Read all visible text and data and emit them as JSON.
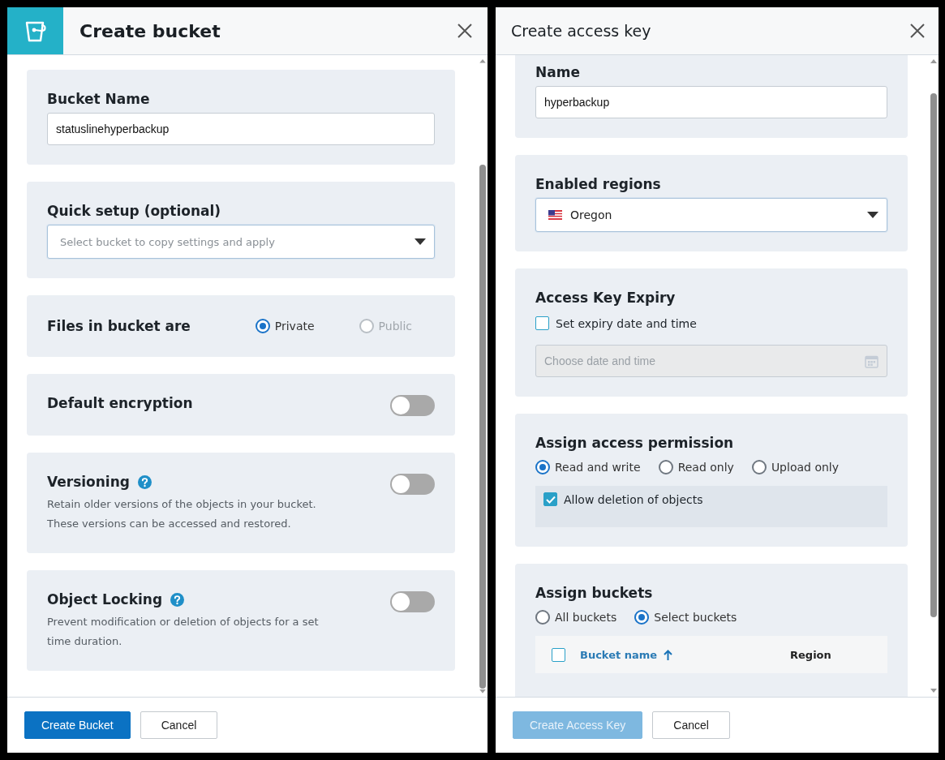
{
  "create_bucket": {
    "title": "Create bucket",
    "bucket_name": {
      "label": "Bucket Name",
      "value": "statuslinehyperbackup"
    },
    "quick_setup": {
      "label": "Quick setup (optional)",
      "placeholder": "Select bucket to copy settings and apply"
    },
    "files_access": {
      "label": "Files in bucket are",
      "options": [
        {
          "label": "Private",
          "selected": true,
          "disabled": false
        },
        {
          "label": "Public",
          "selected": false,
          "disabled": true
        }
      ]
    },
    "toggles": [
      {
        "label": "Default encryption",
        "on": false,
        "help": false
      },
      {
        "label": "Versioning",
        "on": false,
        "help": true,
        "description": "Retain older versions of the objects in your bucket.\nThese versions can be accessed and restored."
      },
      {
        "label": "Object Locking",
        "on": false,
        "help": true,
        "description": "Prevent modification or deletion of objects for a set\ntime duration."
      }
    ],
    "buttons": [
      {
        "label": "Create Bucket",
        "kind": "primary",
        "disabled": false
      },
      {
        "label": "Cancel",
        "kind": "secondary",
        "disabled": false
      }
    ]
  },
  "create_access_key": {
    "title": "Create access key",
    "name": {
      "label": "Name",
      "value": "hyperbackup"
    },
    "enabled_regions": {
      "label": "Enabled regions",
      "value": "Oregon"
    },
    "expiry": {
      "title": "Access Key Expiry",
      "checkbox": {
        "label": "Set expiry date and time",
        "checked": false
      },
      "date_field": {
        "placeholder": "Choose date and time",
        "disabled": true
      }
    },
    "permission": {
      "title": "Assign access permission",
      "options": [
        {
          "label": "Read and write",
          "selected": true
        },
        {
          "label": "Read only",
          "selected": false
        },
        {
          "label": "Upload only",
          "selected": false
        }
      ],
      "allow_deletion": {
        "label": "Allow deletion of objects",
        "checked": true
      }
    },
    "assign_buckets": {
      "title": "Assign buckets",
      "options": [
        {
          "label": "All buckets",
          "selected": false
        },
        {
          "label": "Select buckets",
          "selected": true
        }
      ],
      "table": {
        "select_all_checked": false,
        "columns": [
          {
            "label": "Bucket name",
            "sorted": true
          },
          {
            "label": "Region",
            "sorted": false
          }
        ]
      }
    },
    "buttons": [
      {
        "label": "Create Access Key",
        "kind": "primary",
        "disabled": true
      },
      {
        "label": "Cancel",
        "kind": "secondary",
        "disabled": false
      }
    ]
  }
}
